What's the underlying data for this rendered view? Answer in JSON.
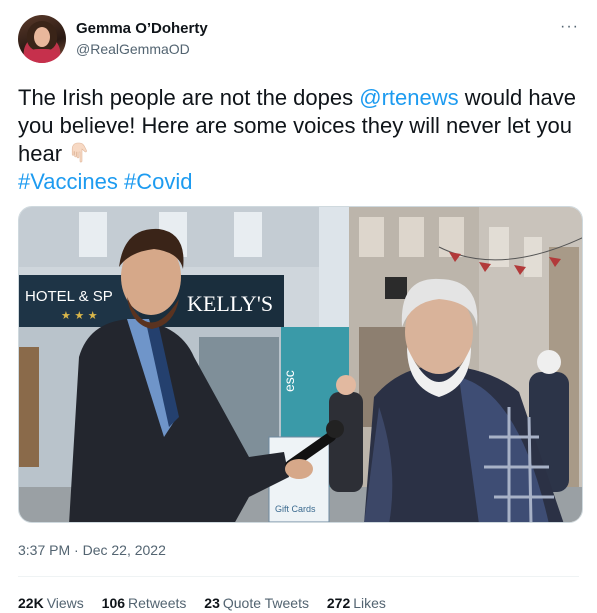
{
  "author": {
    "display_name": "Gemma O’Doherty",
    "handle": "@RealGemmaOD",
    "avatar_icon": "profile-photo"
  },
  "more_icon": "more-horizontal-icon",
  "more_glyph": "···",
  "text": {
    "part1": "The Irish people are not the dopes ",
    "mention": "@rtenews",
    "part2": " would have you believe! Here are some voices they will never let you hear ",
    "emoji": "backhand-index-pointing-down",
    "hashtag1": "#Vaccines",
    "hashtag2": "#Covid"
  },
  "media": {
    "type": "video-still",
    "signs": [
      "HOTEL & SP",
      "KELLY'S",
      "esc",
      "Gift Cards"
    ]
  },
  "timestamp": "3:37 PM · Dec 22, 2022",
  "stats": [
    {
      "count": "22K",
      "label": "Views"
    },
    {
      "count": "106",
      "label": "Retweets"
    },
    {
      "count": "23",
      "label": "Quote Tweets"
    },
    {
      "count": "272",
      "label": "Likes"
    }
  ],
  "colors": {
    "link": "#1d9bf0",
    "text": "#0f1419",
    "secondary": "#536471"
  }
}
